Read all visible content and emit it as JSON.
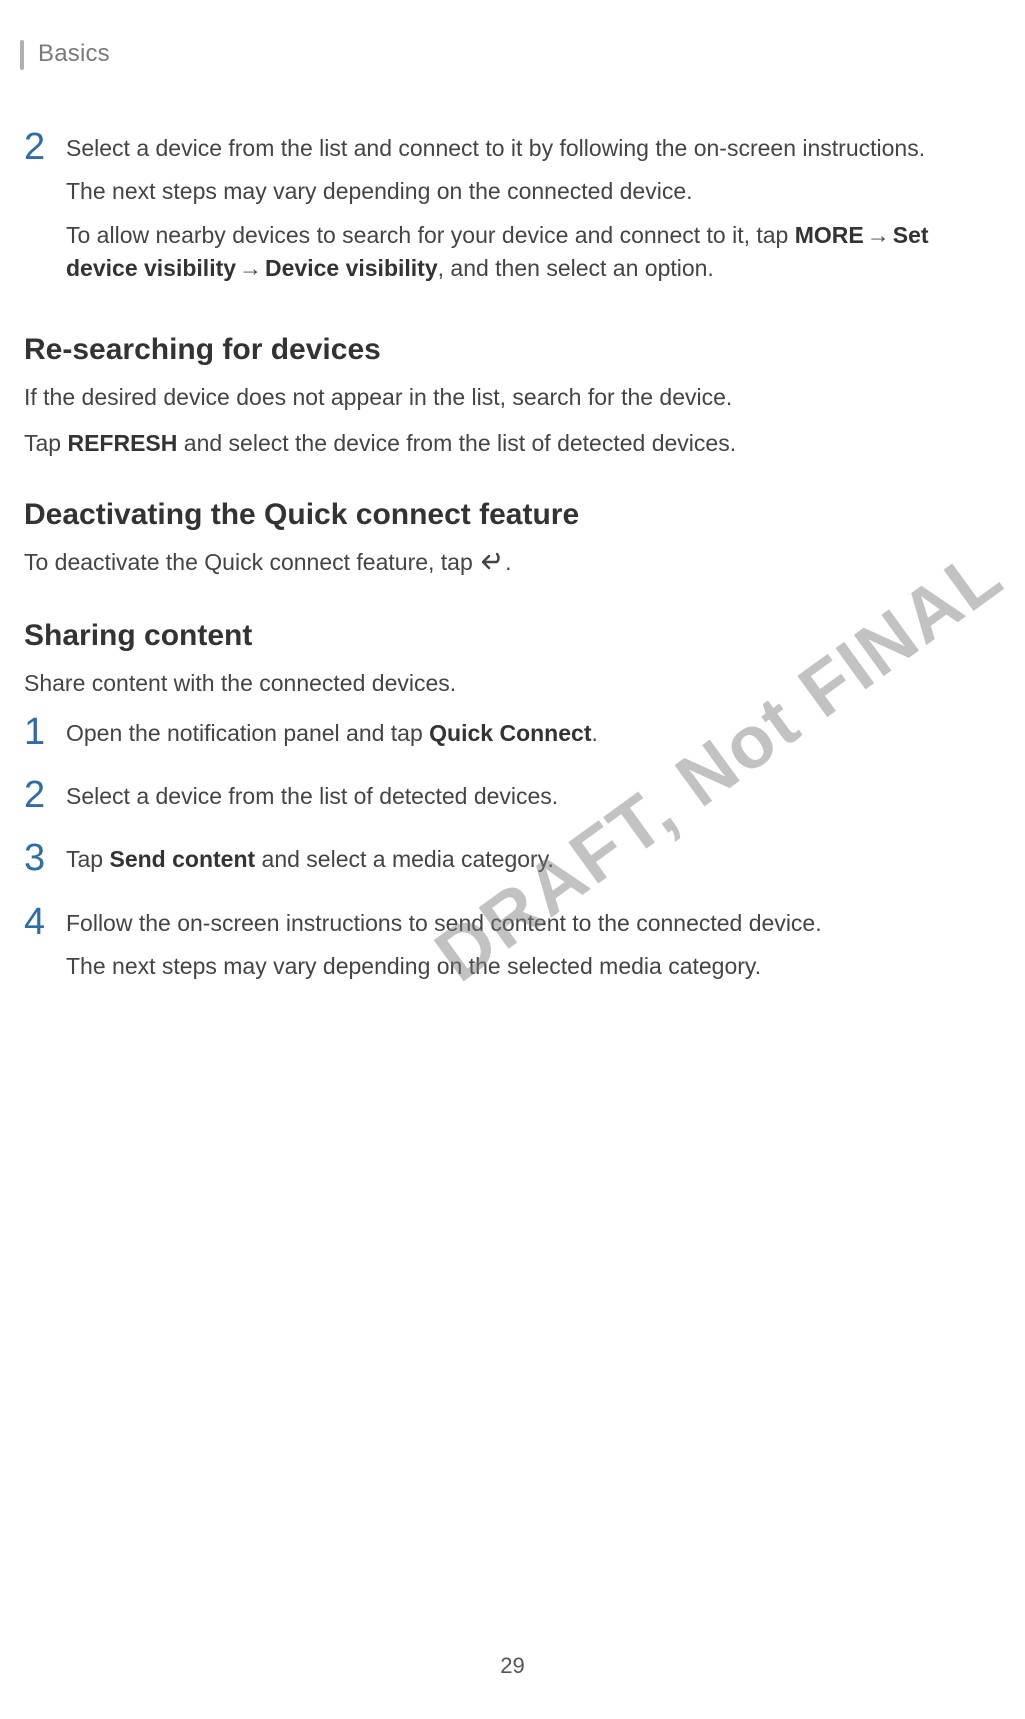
{
  "header": {
    "section": "Basics"
  },
  "step2": {
    "num": "2",
    "p1": "Select a device from the list and connect to it by following the on-screen instructions.",
    "p2": "The next steps may vary depending on the connected device.",
    "p3a": "To allow nearby devices to search for your device and connect to it, tap ",
    "p3_more": "MORE",
    "p3_arrow1": " → ",
    "p3_set": "Set device visibility",
    "p3_arrow2": " → ",
    "p3_devvis": "Device visibility",
    "p3b": ", and then select an option."
  },
  "resear": {
    "heading": "Re-searching for devices",
    "p1": "If the desired device does not appear in the list, search for the device.",
    "p2a": "Tap ",
    "p2_refresh": "REFRESH",
    "p2b": " and select the device from the list of detected devices."
  },
  "deact": {
    "heading": "Deactivating the Quick connect feature",
    "p1a": "To deactivate the Quick connect feature, tap ",
    "p1b": "."
  },
  "sharing": {
    "heading": "Sharing content",
    "intro": "Share content with the connected devices.",
    "s1": {
      "num": "1",
      "a": "Open the notification panel and tap ",
      "bold": "Quick Connect",
      "b": "."
    },
    "s2": {
      "num": "2",
      "text": "Select a device from the list of detected devices."
    },
    "s3": {
      "num": "3",
      "a": "Tap ",
      "bold": "Send content",
      "b": " and select a media category."
    },
    "s4": {
      "num": "4",
      "p1": "Follow the on-screen instructions to send content to the connected device.",
      "p2": "The next steps may vary depending on the selected media category."
    }
  },
  "watermark": "DRAFT, Not FINAL",
  "page_number": "29"
}
